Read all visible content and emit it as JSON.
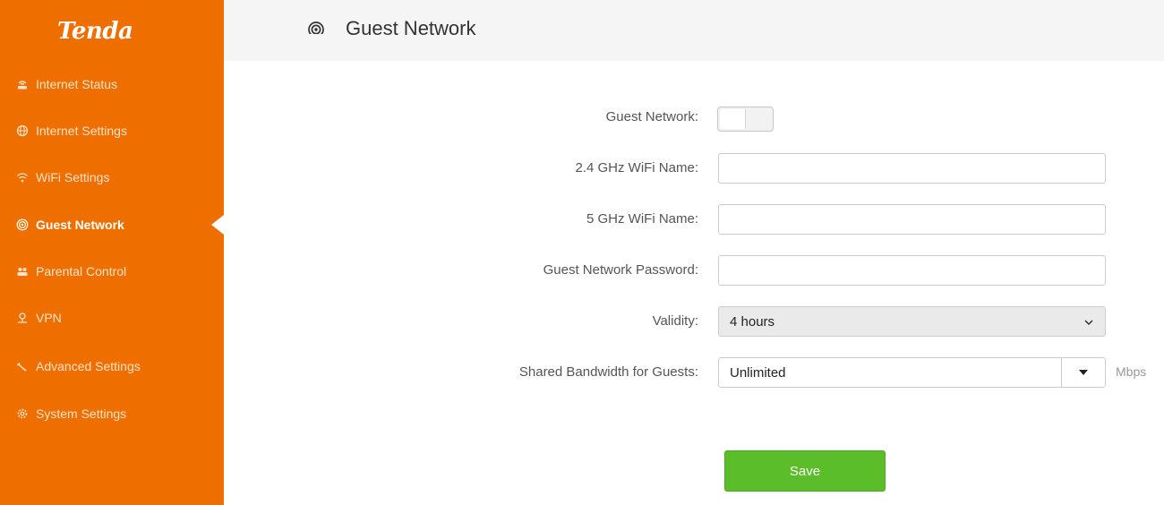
{
  "brand": {
    "logo_text": "Tenda",
    "primary_color": "#ee6f00",
    "save_color": "#5cbd2a"
  },
  "sidebar": {
    "items": [
      {
        "label": "Internet Status",
        "icon": "router-icon",
        "active": false
      },
      {
        "label": "Internet Settings",
        "icon": "globe-icon",
        "active": false
      },
      {
        "label": "WiFi Settings",
        "icon": "wifi-icon",
        "active": false
      },
      {
        "label": "Guest Network",
        "icon": "guest-network-icon",
        "active": true
      },
      {
        "label": "Parental Control",
        "icon": "parental-control-icon",
        "active": false
      },
      {
        "label": "VPN",
        "icon": "vpn-icon",
        "active": false
      },
      {
        "label": "Advanced Settings",
        "icon": "wrench-icon",
        "active": false
      },
      {
        "label": "System Settings",
        "icon": "gear-icon",
        "active": false
      }
    ]
  },
  "header": {
    "title": "Guest Network",
    "icon": "guest-network-icon"
  },
  "form": {
    "guest_network": {
      "label": "Guest Network:",
      "enabled": false
    },
    "wifi_24": {
      "label": "2.4 GHz WiFi Name:",
      "value": ""
    },
    "wifi_5": {
      "label": "5 GHz WiFi Name:",
      "value": ""
    },
    "password": {
      "label": "Guest Network Password:",
      "value": ""
    },
    "validity": {
      "label": "Validity:",
      "value": "4 hours"
    },
    "bandwidth": {
      "label": "Shared Bandwidth for Guests:",
      "value": "Unlimited",
      "unit": "Mbps"
    },
    "save_label": "Save"
  }
}
